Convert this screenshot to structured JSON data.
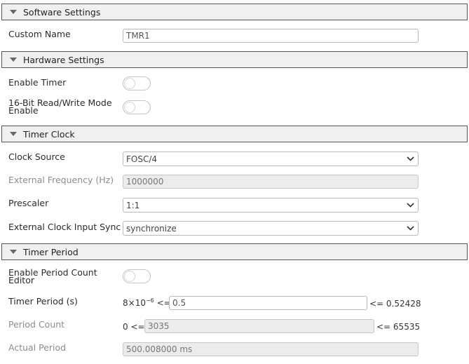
{
  "software_settings": {
    "title": "Software Settings",
    "custom_name_label": "Custom Name",
    "custom_name_value": "TMR1"
  },
  "hardware_settings": {
    "title": "Hardware Settings",
    "enable_timer_label": "Enable Timer",
    "enable_timer_on": false,
    "rw16_label_line1": "16-Bit Read/Write Mode",
    "rw16_label_line2": "Enable",
    "rw16_on": false
  },
  "timer_clock": {
    "title": "Timer Clock",
    "clock_source_label": "Clock Source",
    "clock_source_value": "FOSC/4",
    "external_freq_label": "External Frequency (Hz)",
    "external_freq_value": "1000000",
    "prescaler_label": "Prescaler",
    "prescaler_value": "1:1",
    "ext_sync_label": "External Clock Input Sync",
    "ext_sync_value": "synchronize"
  },
  "timer_period": {
    "title": "Timer Period",
    "enable_period_label_line1": "Enable Period Count",
    "enable_period_label_line2": "Editor",
    "enable_period_on": false,
    "timer_period_label": "Timer Period (s)",
    "timer_period_min_base": "8×10",
    "timer_period_min_exp": "−6",
    "timer_period_min_op": "<=",
    "timer_period_value": "0.5",
    "timer_period_max": "<= 0.52428",
    "period_count_label": "Period Count",
    "period_count_min": "0 <=",
    "period_count_value": "3035",
    "period_count_max": "<= 65535",
    "actual_period_label": "Actual Period",
    "actual_period_value": "500.008000 ms"
  },
  "icons": {
    "collapse": "triangle-down-icon",
    "dropdown": "chevron-down-icon"
  }
}
